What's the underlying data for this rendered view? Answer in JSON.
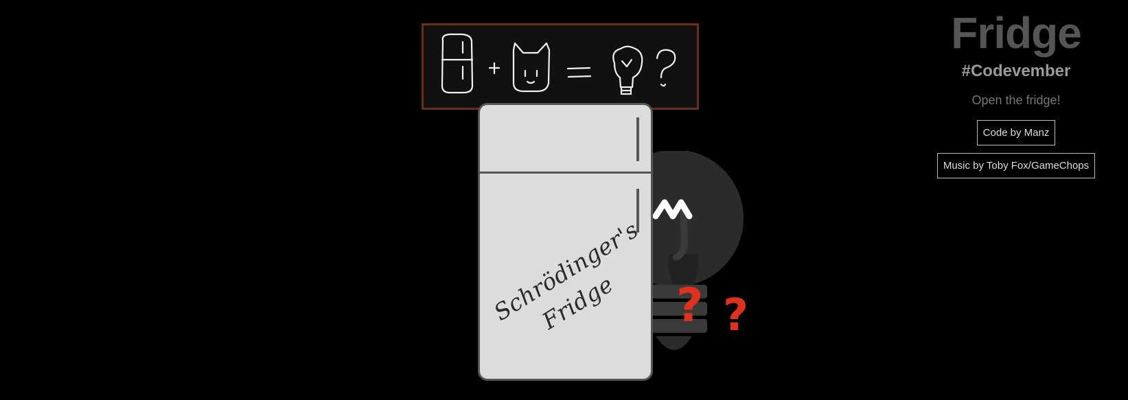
{
  "header": {
    "title": "Fridge",
    "subtitle": "#Codevember",
    "hint": "Open the fridge!"
  },
  "links": {
    "code_label": "Code by Manz",
    "music_label": "Music by Toby Fox/GameChops"
  },
  "fridge": {
    "label_line1": "Schrödinger's",
    "label_line2": "Fridge"
  },
  "question_marks": [
    "?",
    "?"
  ],
  "icons": {
    "chalkboard": "chalk-equation-fridge-plus-cat-equals-idea-question",
    "bulb": "light-bulb-icon"
  },
  "colors": {
    "background": "#000000",
    "fridge_body": "#dcdcdc",
    "fridge_outline": "#555555",
    "chalkboard_frame": "#6a2f14",
    "question_mark": "#e0301e",
    "title": "#555555"
  }
}
